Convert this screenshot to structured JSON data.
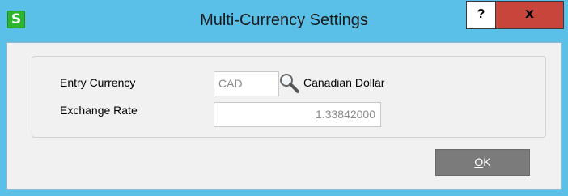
{
  "window": {
    "title": "Multi-Currency Settings",
    "app_icon_letter": "S",
    "help_label": "?",
    "close_label": "x"
  },
  "form": {
    "entry_currency_label": "Entry Currency",
    "entry_currency_value": "CAD",
    "currency_name": "Canadian Dollar",
    "exchange_rate_label": "Exchange Rate",
    "exchange_rate_value": "1.33842000"
  },
  "buttons": {
    "ok_mnemonic": "O",
    "ok_rest": "K"
  },
  "icons": {
    "lookup": "magnifier-icon"
  },
  "colors": {
    "title_bar": "#5bc0e8",
    "close_button": "#c7453b",
    "app_icon": "#2db52d",
    "ok_button": "#7b7b7b"
  }
}
